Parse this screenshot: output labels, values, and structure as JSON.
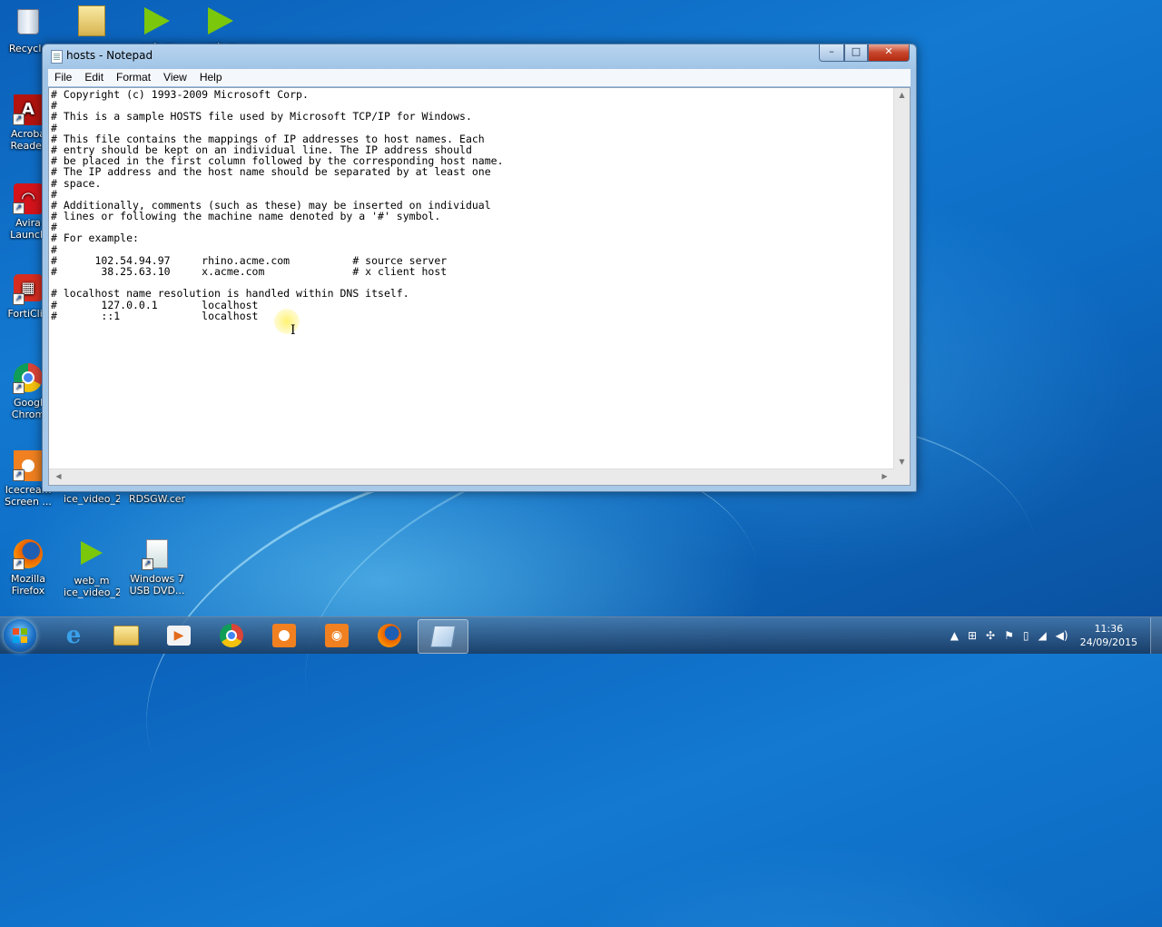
{
  "desktop": {
    "icons": [
      {
        "label": "Recycle"
      },
      {
        "label": "Acroba\nReader"
      },
      {
        "label": "Avira\nLaunch"
      },
      {
        "label": "FortiClie"
      },
      {
        "label": "Googl\nChrom"
      },
      {
        "label": "Icecream\nScreen ..."
      },
      {
        "label": "Mozilla\nFirefox"
      },
      {
        "label": "web_m"
      },
      {
        "label": "web_m"
      },
      {
        "label": "ice_video_2..."
      },
      {
        "label": "RDSGW.cer"
      },
      {
        "label": "web_m\nice_video_2..."
      },
      {
        "label": "Windows 7\nUSB DVD..."
      }
    ]
  },
  "window": {
    "title": "hosts - Notepad",
    "controls": {
      "minimize": "–",
      "maximize": "□",
      "close": "✕"
    },
    "menu": [
      "File",
      "Edit",
      "Format",
      "View",
      "Help"
    ],
    "lines": [
      "# Copyright (c) 1993-2009 Microsoft Corp.",
      "#",
      "# This is a sample HOSTS file used by Microsoft TCP/IP for Windows.",
      "#",
      "# This file contains the mappings of IP addresses to host names. Each",
      "# entry should be kept on an individual line. The IP address should",
      "# be placed in the first column followed by the corresponding host name.",
      "# The IP address and the host name should be separated by at least one",
      "# space.",
      "#",
      "# Additionally, comments (such as these) may be inserted on individual",
      "# lines or following the machine name denoted by a '#' symbol.",
      "#",
      "# For example:",
      "#",
      "#      102.54.94.97     rhino.acme.com          # source server",
      "#       38.25.63.10     x.acme.com              # x client host",
      "",
      "# localhost name resolution is handled within DNS itself.",
      "#\t127.0.0.1       localhost",
      "#\t::1             localhost"
    ]
  },
  "taskbar": {
    "apps": [
      "internet-explorer",
      "file-explorer",
      "media-player",
      "google-chrome",
      "icecream-screen-recorder",
      "icecream-screen-capture",
      "mozilla-firefox",
      "notepad"
    ],
    "active_app": "notepad",
    "clock": {
      "time": "11:36",
      "date": "24/09/2015"
    }
  }
}
